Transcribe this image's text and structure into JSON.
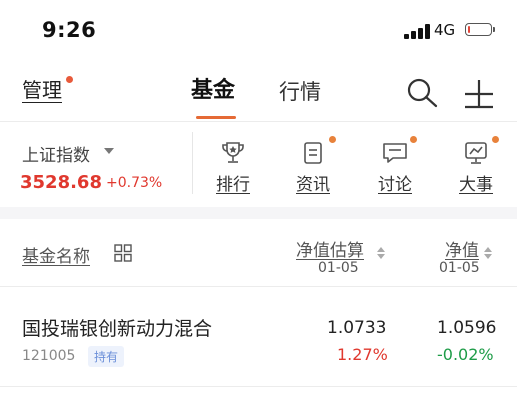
{
  "status_bar": {
    "time": "9:26",
    "network": "4G",
    "battery_level": 0.12
  },
  "header": {
    "manage_label": "管理",
    "tab_fund": "基金",
    "tab_market": "行情",
    "search_icon": "search-icon",
    "add_icon": "plus-icon"
  },
  "index": {
    "name": "上证指数",
    "value": "3528.68",
    "change": "+0.73%"
  },
  "quick_links": [
    {
      "label": "排行",
      "icon": "trophy-icon",
      "dot": false
    },
    {
      "label": "资讯",
      "icon": "document-icon",
      "dot": true
    },
    {
      "label": "讨论",
      "icon": "chat-icon",
      "dot": true
    },
    {
      "label": "大事",
      "icon": "chart-monitor-icon",
      "dot": true
    }
  ],
  "table_header": {
    "name_col": "基金名称",
    "est_col": "净值估算",
    "est_date": "01-05",
    "nav_col": "净值",
    "nav_date": "01-05"
  },
  "funds": [
    {
      "name": "国投瑞银创新动力混合",
      "code": "121005",
      "badge": "持有",
      "est_value": "1.0733",
      "est_change": "1.27%",
      "nav_value": "1.0596",
      "nav_change": "-0.02%"
    }
  ],
  "colors": {
    "up": "#e0382e",
    "down": "#1e9c48",
    "accent": "#e56a35",
    "dot": "#e8823b"
  }
}
